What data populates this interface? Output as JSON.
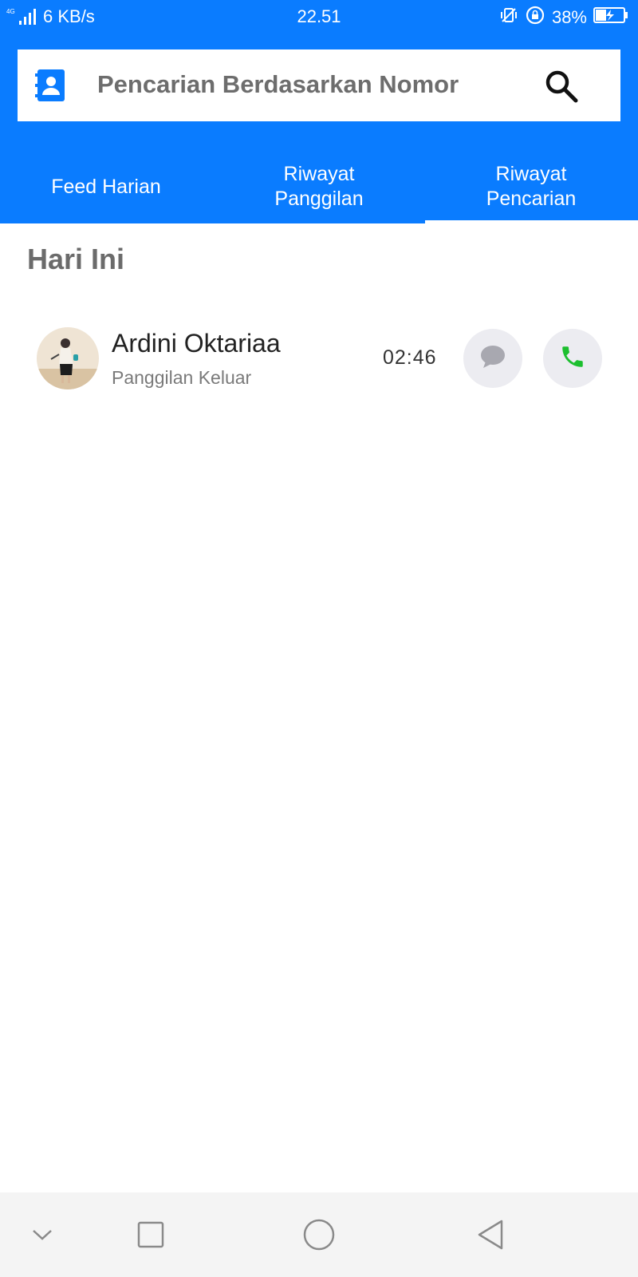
{
  "status_bar": {
    "network_type": "4G",
    "speed": "6 KB/s",
    "time": "22.51",
    "battery_percent": "38%",
    "icons": [
      "signal-icon",
      "vibrate-icon",
      "rotation-lock-icon",
      "battery-charging-icon"
    ]
  },
  "search": {
    "placeholder": "Pencarian Berdasarkan Nomor"
  },
  "tabs": [
    {
      "line1": "Feed Harian",
      "line2": ""
    },
    {
      "line1": "Riwayat",
      "line2": "Panggilan"
    },
    {
      "line1": "Riwayat",
      "line2": "Pencarian"
    }
  ],
  "active_tab_index": 2,
  "section": {
    "title": "Hari Ini"
  },
  "calls": [
    {
      "name": "Ardini Oktariaa",
      "type": "Panggilan Keluar",
      "time": "02:46"
    }
  ],
  "colors": {
    "brand_blue": "#0a7cff",
    "call_green": "#1cbf2f",
    "message_gray": "#a8a8b0"
  }
}
